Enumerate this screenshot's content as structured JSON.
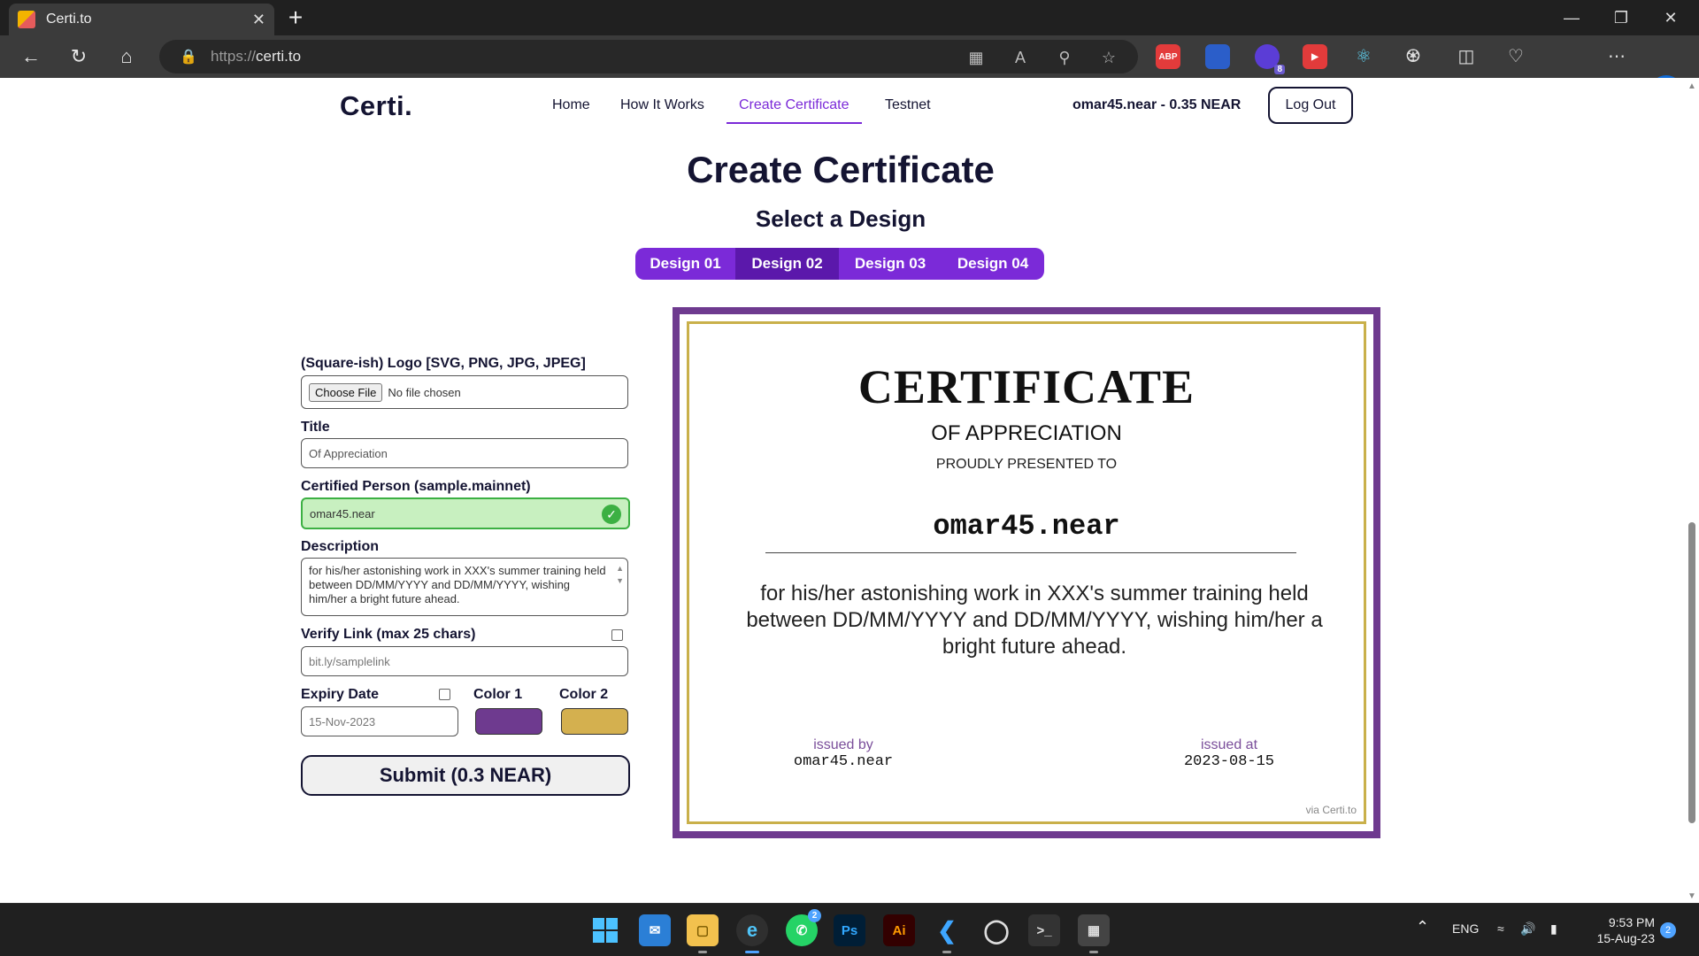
{
  "browser": {
    "tab_title": "Certi.to",
    "tab_close": "✕",
    "new_tab": "+",
    "url_proto": "https://",
    "url_host": "certi.to",
    "extensions": [
      {
        "name": "adblock-plus",
        "label": "ABP",
        "color": "#e33b3b"
      },
      {
        "name": "extension-blue",
        "label": "",
        "color": "#2b5ec9"
      },
      {
        "name": "extension-purple",
        "label": "",
        "color": "#5b3dd6",
        "badge": "8"
      },
      {
        "name": "extension-youtube",
        "label": "",
        "color": "#e23b3b"
      },
      {
        "name": "react-devtools",
        "label": "",
        "color": "#3b3b3b"
      }
    ]
  },
  "site": {
    "brand": "Certi.",
    "nav": [
      "Home",
      "How It Works",
      "Create Certificate",
      "Testnet"
    ],
    "active_nav": "Create Certificate",
    "account": "omar45.near - 0.35 NEAR",
    "logout": "Log Out"
  },
  "page": {
    "title": "Create Certificate",
    "design_heading": "Select a Design",
    "designs": [
      "Design 01",
      "Design 02",
      "Design 03",
      "Design 04"
    ],
    "selected_design": "Design 02"
  },
  "form": {
    "logo_label": "(Square-ish) Logo [SVG, PNG, JPG, JPEG]",
    "choose_file": "Choose File",
    "no_file": "No file chosen",
    "title_label": "Title",
    "title_value": "Of Appreciation",
    "person_label": "Certified Person (sample.mainnet)",
    "person_value": "omar45.near",
    "description_label": "Description",
    "description_value": "for his/her astonishing work in XXX's summer training held between DD/MM/YYYY and DD/MM/YYYY, wishing him/her a bright future ahead.",
    "verify_label": "Verify Link (max 25 chars)",
    "verify_placeholder": "bit.ly/samplelink",
    "expiry_label": "Expiry Date",
    "expiry_value": "15-Nov-2023",
    "color1_label": "Color 1",
    "color2_label": "Color 2",
    "color1": "#6e3a8f",
    "color2": "#d4b04f",
    "submit": "Submit (0.3 NEAR)"
  },
  "certificate": {
    "heading": "CERTIFICATE",
    "subheading": "OF APPRECIATION",
    "presented": "PROUDLY PRESENTED TO",
    "name": "omar45.near",
    "description": "for his/her astonishing work in XXX's summer training held between DD/MM/YYYY and DD/MM/YYYY, wishing him/her a bright future ahead.",
    "issued_by_label": "issued by",
    "issued_by": "omar45.near",
    "issued_at_label": "issued at",
    "issued_at": "2023-08-15",
    "via": "via Certi.to"
  },
  "taskbar": {
    "whatsapp_badge": "2",
    "ps_label": "Ps",
    "ai_label": "Ai",
    "language": "ENG",
    "time": "9:53 PM",
    "date": "15-Aug-23",
    "notifications": "2"
  }
}
